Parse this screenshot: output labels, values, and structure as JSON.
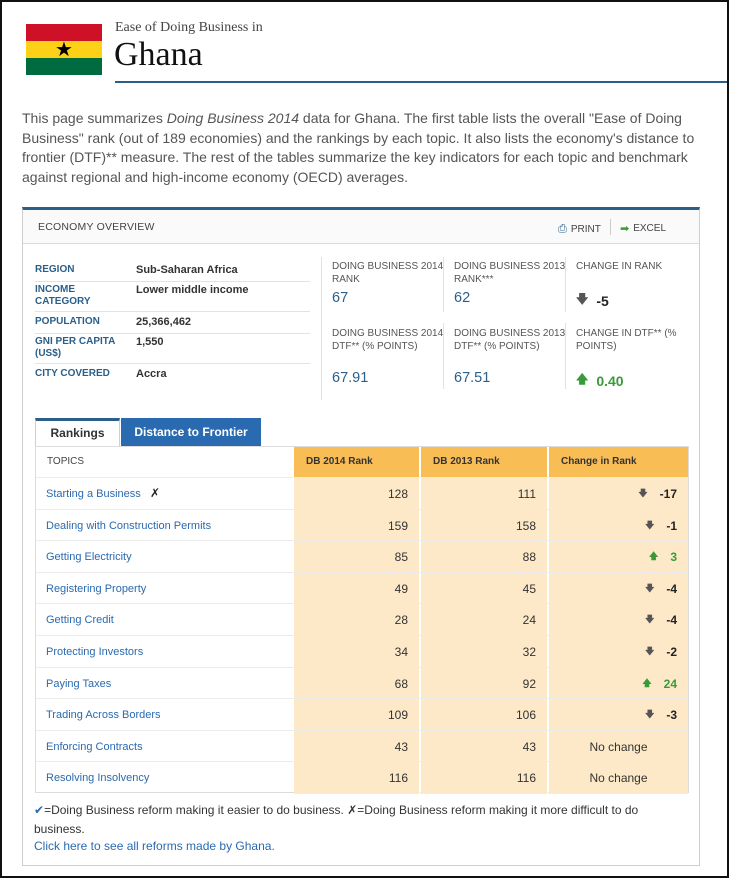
{
  "header": {
    "subtitle": "Ease of Doing Business in",
    "country": "Ghana",
    "flag_star": "★"
  },
  "intro": {
    "before": "This page summarizes ",
    "italic": "Doing Business 2014",
    "after": " data for Ghana. The first table lists the overall \"Ease of Doing Business\" rank (out of 189 economies) and the rankings by each topic. It also lists the economy's distance to frontier (DTF)** measure. The rest of the tables summarize the key indicators for each topic and benchmark against regional and high-income economy (OECD) averages."
  },
  "panel": {
    "title": "ECONOMY OVERVIEW",
    "print_label": "PRINT",
    "excel_label": "EXCEL"
  },
  "facts": [
    {
      "key": "REGION",
      "value": "Sub-Saharan Africa"
    },
    {
      "key": "INCOME CATEGORY",
      "value": "Lower middle income"
    },
    {
      "key": "POPULATION",
      "value": "25,366,462"
    },
    {
      "key": "GNI PER CAPITA (US$)",
      "value": "1,550"
    },
    {
      "key": "CITY COVERED",
      "value": "Accra"
    }
  ],
  "stats": {
    "db2014_rank_label": "DOING BUSINESS 2014 RANK",
    "db2014_rank": "67",
    "db2013_rank_label": "DOING BUSINESS 2013 RANK***",
    "db2013_rank": "62",
    "change_rank_label": "CHANGE IN RANK",
    "change_rank": "-5",
    "db2014_dtf_label": "DOING BUSINESS 2014 DTF** (% POINTS)",
    "db2014_dtf": "67.91",
    "db2013_dtf_label": "DOING BUSINESS 2013 DTF** (% POINTS)",
    "db2013_dtf": "67.51",
    "change_dtf_label": "CHANGE IN DTF** (% POINTS)",
    "change_dtf": "0.40"
  },
  "tabs": {
    "rankings": "Rankings",
    "dtf": "Distance to Frontier"
  },
  "table": {
    "headers": {
      "topics": "TOPICS",
      "db2014": "DB 2014 Rank",
      "db2013": "DB 2013 Rank",
      "change": "Change in Rank"
    },
    "rows": [
      {
        "topic": "Starting a Business",
        "mark": "✗",
        "db2014": "128",
        "db2013": "111",
        "change": "-17",
        "dir": "down"
      },
      {
        "topic": "Dealing with Construction Permits",
        "mark": "",
        "db2014": "159",
        "db2013": "158",
        "change": "-1",
        "dir": "down"
      },
      {
        "topic": "Getting Electricity",
        "mark": "",
        "db2014": "85",
        "db2013": "88",
        "change": "3",
        "dir": "up"
      },
      {
        "topic": "Registering Property",
        "mark": "",
        "db2014": "49",
        "db2013": "45",
        "change": "-4",
        "dir": "down"
      },
      {
        "topic": "Getting Credit",
        "mark": "",
        "db2014": "28",
        "db2013": "24",
        "change": "-4",
        "dir": "down"
      },
      {
        "topic": "Protecting Investors",
        "mark": "",
        "db2014": "34",
        "db2013": "32",
        "change": "-2",
        "dir": "down"
      },
      {
        "topic": "Paying Taxes",
        "mark": "",
        "db2014": "68",
        "db2013": "92",
        "change": "24",
        "dir": "up"
      },
      {
        "topic": "Trading Across Borders",
        "mark": "",
        "db2014": "109",
        "db2013": "106",
        "change": "-3",
        "dir": "down"
      },
      {
        "topic": "Enforcing Contracts",
        "mark": "",
        "db2014": "43",
        "db2013": "43",
        "change": "No change",
        "dir": "none"
      },
      {
        "topic": "Resolving Insolvency",
        "mark": "",
        "db2014": "116",
        "db2013": "116",
        "change": "No change",
        "dir": "none"
      }
    ]
  },
  "legend": {
    "check": "✔",
    "check_text": "=Doing Business reform making it easier to do business. ",
    "cross": "✗",
    "cross_text": "=Doing Business reform making it more difficult to do business.",
    "link": "Click here to see all reforms made by Ghana."
  },
  "colors": {
    "accent": "#2a5f8a",
    "link": "#2a6ab0",
    "header_orange": "#f8bd55",
    "cell_orange": "#fde9c8",
    "up_green": "#3a9a3a"
  }
}
